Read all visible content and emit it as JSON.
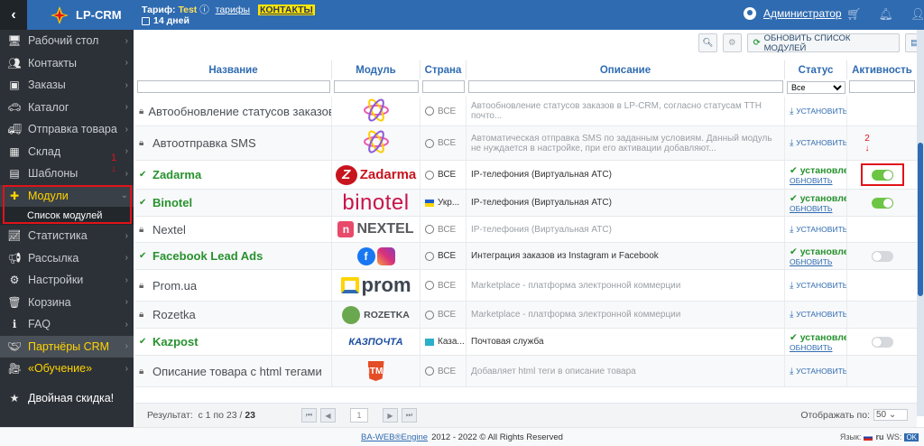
{
  "topbar": {
    "back_icon": "chevron-left-icon",
    "logo_text": "LP-CRM",
    "tariff_label": "Тариф:",
    "tariff_value": "Test",
    "tariffs_link": "тарифы",
    "contacts_link": "КОНТАКТЫ",
    "days": "14 дней",
    "user_name": "Администратор"
  },
  "sidebar": {
    "items": [
      {
        "label": "Рабочий стол",
        "icon": "monitor-icon"
      },
      {
        "label": "Контакты",
        "icon": "users-icon"
      },
      {
        "label": "Заказы",
        "icon": "money-icon"
      },
      {
        "label": "Каталог",
        "icon": "car-icon"
      },
      {
        "label": "Отправка товара",
        "icon": "truck-icon"
      },
      {
        "label": "Склад",
        "icon": "box-icon"
      },
      {
        "label": "Шаблоны",
        "icon": "file-icon"
      },
      {
        "label": "Модули",
        "icon": "puzzle-icon"
      }
    ],
    "subitem": "Список модулей",
    "items2": [
      {
        "label": "Статистика",
        "icon": "chart-icon"
      },
      {
        "label": "Рассылка",
        "icon": "megaphone-icon"
      },
      {
        "label": "Настройки",
        "icon": "gear-icon"
      },
      {
        "label": "Корзина",
        "icon": "trash-icon"
      },
      {
        "label": "FAQ",
        "icon": "info-icon"
      },
      {
        "label": "Партнёры CRM",
        "icon": "handshake-icon"
      },
      {
        "label": "«Обучение»",
        "icon": "video-icon"
      }
    ],
    "bottom_items": [
      {
        "label": "Двойная скидка!",
        "icon": "star-icon"
      }
    ],
    "annotation_1": "1"
  },
  "toolbar": {
    "update_label": "ОБНОВИТЬ СПИСОК МОДУЛЕЙ"
  },
  "table": {
    "headers": {
      "name": "Название",
      "module": "Модуль",
      "country": "Страна",
      "description": "Описание",
      "status": "Статус",
      "active": "Активность"
    },
    "status_filter": "Все",
    "install_label": "УСТАНОВИТЬ",
    "installed_label": "установлен",
    "update_label": "ОБНОВИТЬ",
    "rows": [
      {
        "name": "Автообновление статусов заказов",
        "logo": "atom",
        "country": "ВСЕ",
        "description": "Автообновление статусов заказов в LP-CRM, согласно статусам ТТН почто...",
        "installed": false
      },
      {
        "name": "Автоотправка SMS",
        "logo": "atom",
        "country": "ВСЕ",
        "description": "Автоматическая отправка SMS по заданным условиям. Данный модуль не нуждается в настройке, при его активации добавляют...",
        "installed": false
      },
      {
        "name": "Zadarma",
        "logo": "zadarma",
        "logo_text": "Zadarma",
        "country": "ВСЕ",
        "description": "IP-телефония (Виртуальная АТС)",
        "installed": true,
        "active": true
      },
      {
        "name": "Binotel",
        "logo": "binotel",
        "logo_text": "binotel",
        "country": "Укр...",
        "description": "IP-телефония (Виртуальная АТС)",
        "installed": true,
        "active": true
      },
      {
        "name": "Nextel",
        "logo": "nextel",
        "logo_text": "NEXTEL",
        "country": "ВСЕ",
        "description": "IP-телефония (Виртуальная АТС)",
        "installed": false
      },
      {
        "name": "Facebook Lead Ads",
        "logo": "facebook",
        "country": "ВСЕ",
        "description": "Интеграция заказов из Instagram и Facebook",
        "installed": true,
        "active": false
      },
      {
        "name": "Prom.ua",
        "logo": "prom",
        "logo_text": "prom",
        "country": "ВСЕ",
        "description": "Marketplace - платформа электронной коммерции",
        "installed": false
      },
      {
        "name": "Rozetka",
        "logo": "rozetka",
        "logo_text": "ROZETKA",
        "country": "ВСЕ",
        "description": "Marketplace - платформа электронной коммерции",
        "installed": false
      },
      {
        "name": "Kazpost",
        "logo": "kazpost",
        "logo_text": "КАЗПОЧТА",
        "country": "Каза...",
        "description": "Почтовая служба",
        "installed": true,
        "active": false
      },
      {
        "name": "Описание товара с html тегами",
        "logo": "html5",
        "logo_text": "HTML",
        "country": "ВСЕ",
        "description": "Добавляет html теги в описание товара",
        "installed": false
      }
    ],
    "annotation_2": "2"
  },
  "pager": {
    "result_label": "Результат:",
    "result_range": "с 1 по 23 /",
    "total": "23",
    "page": "1",
    "per_page_label": "Отображать по:",
    "per_page": "50"
  },
  "footer": {
    "engine_link": "BA-WEB®Engine",
    "copyright": "2012 - 2022 © All Rights Reserved",
    "lang_label": "Язык:",
    "lang": "ru",
    "ws_label": "WS:",
    "ws_status": "OK"
  },
  "colors": {
    "accent": "#2f6bb1",
    "sidebar": "#2c3137",
    "active_yellow": "#ffd400",
    "success": "#27922e",
    "annotation": "#e0131a"
  }
}
